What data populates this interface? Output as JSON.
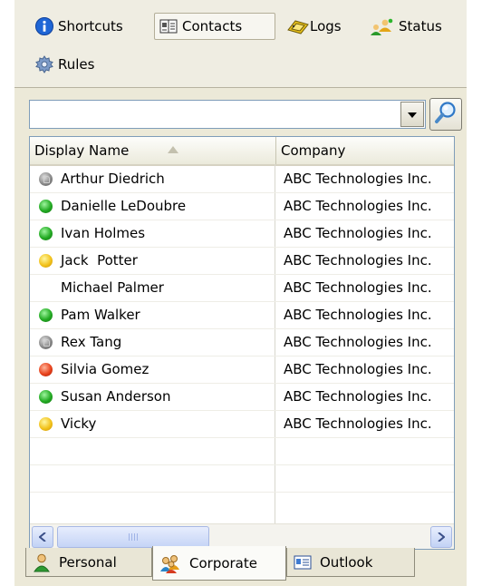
{
  "toolbar": {
    "tabs": [
      {
        "label": "Shortcuts",
        "icon": "info-icon"
      },
      {
        "label": "Contacts",
        "icon": "address-book-icon"
      },
      {
        "label": "Logs",
        "icon": "phone-log-icon"
      },
      {
        "label": "Status",
        "icon": "users-status-icon"
      },
      {
        "label": "Rules",
        "icon": "gear-rules-icon"
      }
    ],
    "active": "Contacts"
  },
  "search": {
    "value": "",
    "dropdown_icon": "chevron-down-icon",
    "button_icon": "magnifier-icon"
  },
  "grid": {
    "columns": [
      {
        "label": "Display Name",
        "sorted": "ascending"
      },
      {
        "label": "Company"
      }
    ],
    "rows": [
      {
        "name": "Arthur Diedrich",
        "company": "ABC Technologies Inc.",
        "status": "offline"
      },
      {
        "name": "Danielle LeDoubre",
        "company": "ABC Technologies Inc.",
        "status": "online"
      },
      {
        "name": "Ivan Holmes",
        "company": "ABC Technologies Inc.",
        "status": "online"
      },
      {
        "name": "Jack  Potter",
        "company": "ABC Technologies Inc.",
        "status": "away"
      },
      {
        "name": "Michael Palmer",
        "company": "ABC Technologies Inc.",
        "status": "none"
      },
      {
        "name": "Pam Walker",
        "company": "ABC Technologies Inc.",
        "status": "online"
      },
      {
        "name": "Rex Tang",
        "company": "ABC Technologies Inc.",
        "status": "offline"
      },
      {
        "name": "Silvia Gomez",
        "company": "ABC Technologies Inc.",
        "status": "busy"
      },
      {
        "name": "Susan Anderson",
        "company": "ABC Technologies Inc.",
        "status": "online"
      },
      {
        "name": "Vicky",
        "company": "ABC Technologies Inc.",
        "status": "away"
      }
    ],
    "status_colors": {
      "online": "#22aa22",
      "away": "#f2c21b",
      "busy": "#e8421c",
      "offline": "#8a8a8a"
    }
  },
  "bottom_tabs": [
    {
      "label": "Personal",
      "icon": "person-icon"
    },
    {
      "label": "Corporate",
      "icon": "group-icon"
    },
    {
      "label": "Outlook",
      "icon": "outlook-card-icon"
    }
  ],
  "bottom_active": "Corporate"
}
